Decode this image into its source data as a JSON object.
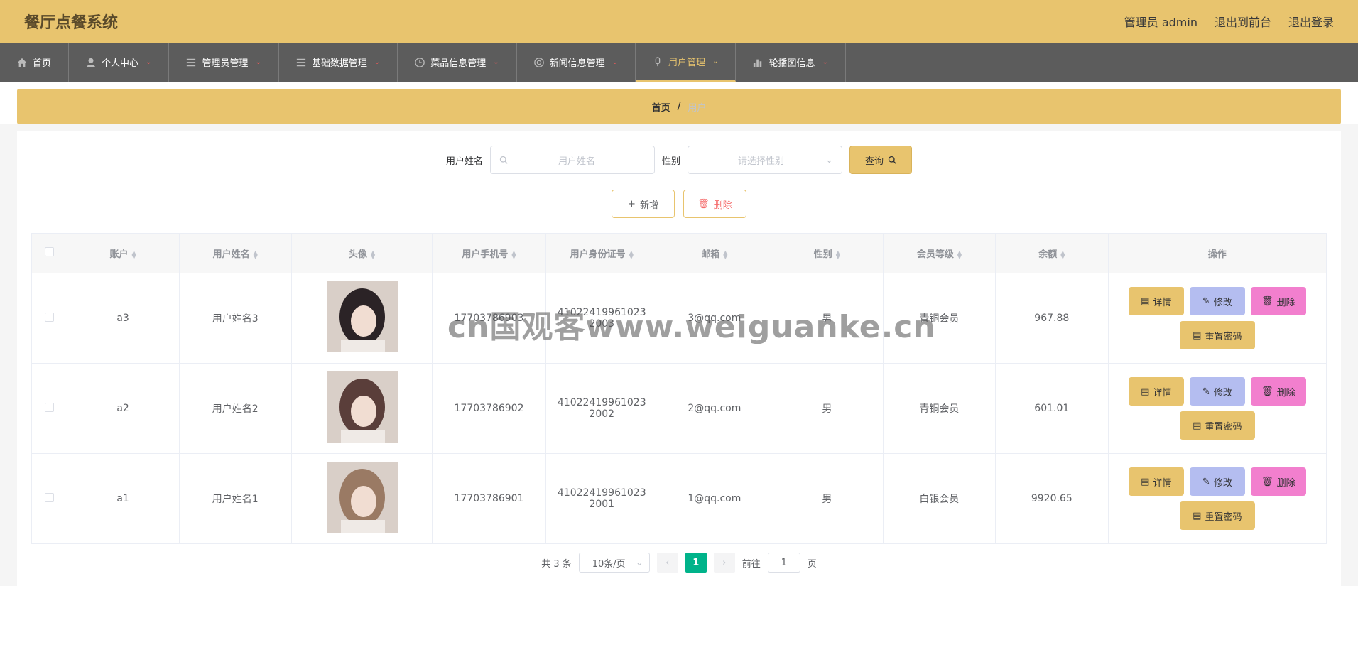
{
  "app": {
    "title": "餐厅点餐系统"
  },
  "header": {
    "user": "管理员 admin",
    "to_front": "退出到前台",
    "logout": "退出登录"
  },
  "nav": [
    {
      "label": "首页",
      "icon": "home-icon"
    },
    {
      "label": "个人中心",
      "icon": "user-icon"
    },
    {
      "label": "管理员管理",
      "icon": "list-icon"
    },
    {
      "label": "基础数据管理",
      "icon": "list-icon"
    },
    {
      "label": "菜品信息管理",
      "icon": "clock-icon"
    },
    {
      "label": "新闻信息管理",
      "icon": "news-icon"
    },
    {
      "label": "用户管理",
      "icon": "mic-icon"
    },
    {
      "label": "轮播图信息",
      "icon": "chart-icon"
    }
  ],
  "breadcrumb": {
    "home": "首页",
    "sep": "/",
    "current": "用户"
  },
  "search": {
    "name_label": "用户姓名",
    "name_placeholder": "用户姓名",
    "gender_label": "性别",
    "gender_placeholder": "请选择性别",
    "query_label": "查询"
  },
  "actions": {
    "add_label": "新增",
    "delete_label": "删除"
  },
  "table": {
    "columns": [
      "账户",
      "用户姓名",
      "头像",
      "用户手机号",
      "用户身份证号",
      "邮箱",
      "性别",
      "会员等级",
      "余额",
      "操作"
    ],
    "rows": [
      {
        "account": "a3",
        "name": "用户姓名3",
        "phone": "17703786903",
        "id_card": "410224199610232003",
        "email": "3@qq.com",
        "gender": "男",
        "level": "青铜会员",
        "balance": "967.88",
        "avatar_color": "#2b2326"
      },
      {
        "account": "a2",
        "name": "用户姓名2",
        "phone": "17703786902",
        "id_card": "410224199610232002",
        "email": "2@qq.com",
        "gender": "男",
        "level": "青铜会员",
        "balance": "601.01",
        "avatar_color": "#5a3e3a"
      },
      {
        "account": "a1",
        "name": "用户姓名1",
        "phone": "17703786901",
        "id_card": "410224199610232001",
        "email": "1@qq.com",
        "gender": "男",
        "level": "白银会员",
        "balance": "9920.65",
        "avatar_color": "#9a7a64"
      }
    ],
    "row_actions": {
      "detail": "详情",
      "edit": "修改",
      "delete": "删除",
      "reset": "重置密码"
    }
  },
  "pagination": {
    "total": "共 3 条",
    "page_size": "10条/页",
    "current_page": "1",
    "goto_label": "前往",
    "goto_value": "1",
    "page_unit": "页"
  },
  "watermark": "cn国观客www.weiguanke.cn"
}
